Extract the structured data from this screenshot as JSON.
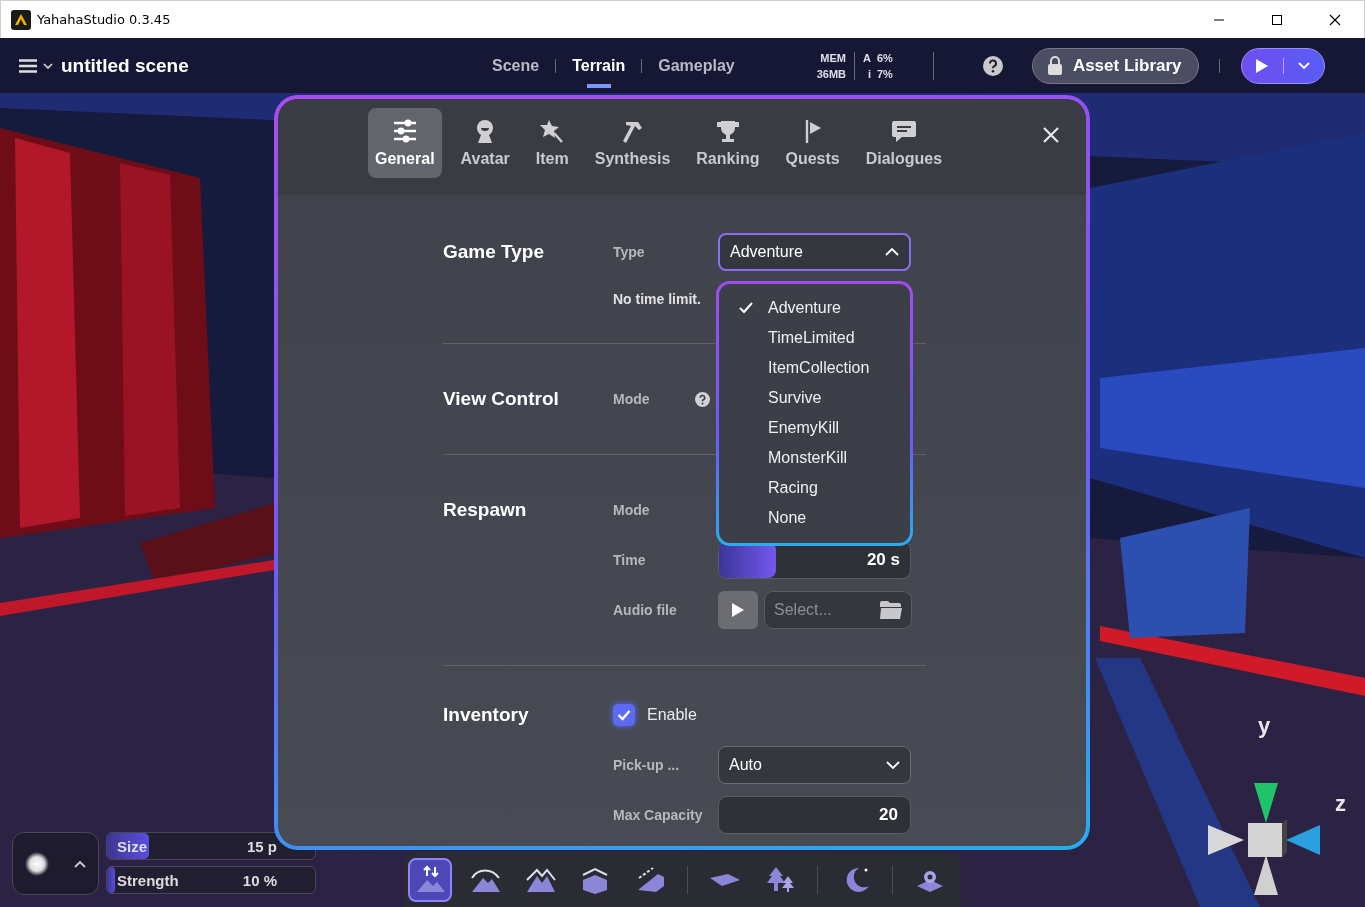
{
  "window": {
    "title": "YahahaStudio 0.3.45"
  },
  "toolbar": {
    "scene_name": "untitled scene",
    "modes": [
      {
        "label": "Scene",
        "selected": false
      },
      {
        "label": "Terrain",
        "selected": true
      },
      {
        "label": "Gameplay",
        "selected": false
      }
    ],
    "stats": {
      "memory": {
        "label": "MEM",
        "value": "36MB"
      },
      "usage": [
        {
          "label": "A",
          "value": "6%"
        },
        {
          "label": "i",
          "value": "7%"
        }
      ]
    },
    "asset_library_button": "Asset Library"
  },
  "dialog": {
    "tabs": [
      {
        "label": "General",
        "selected": true
      },
      {
        "label": "Avatar",
        "selected": false
      },
      {
        "label": "Item",
        "selected": false
      },
      {
        "label": "Synthesis",
        "selected": false
      },
      {
        "label": "Ranking",
        "selected": false
      },
      {
        "label": "Quests",
        "selected": false
      },
      {
        "label": "Dialogues",
        "selected": false
      }
    ],
    "sections": [
      {
        "title": "Game Type",
        "rows": [
          {
            "kind": "select",
            "label": "Type",
            "value": "Adventure",
            "expanded": true
          },
          {
            "kind": "note",
            "text": "No time limit."
          }
        ]
      },
      {
        "title": "View Control",
        "rows": [
          {
            "kind": "covered",
            "label": "Mode",
            "help": true
          }
        ]
      },
      {
        "title": "Respawn",
        "rows": [
          {
            "kind": "covered",
            "label": "Mode",
            "help": false
          },
          {
            "kind": "slider",
            "label": "Time",
            "level": 0.3,
            "reading": "20 s"
          },
          {
            "kind": "file",
            "label": "Audio file",
            "placeholder": "Select..."
          }
        ]
      },
      {
        "title": "Inventory",
        "rows": [
          {
            "kind": "checkbox",
            "label": "Enable",
            "checked": true
          },
          {
            "kind": "select",
            "label": "Pick-up ...",
            "value": "Auto",
            "expanded": false
          },
          {
            "kind": "number",
            "label": "Max Capacity",
            "value": "20"
          }
        ]
      }
    ],
    "dropdown": {
      "options": [
        {
          "label": "Adventure",
          "selected": true
        },
        {
          "label": "TimeLimited",
          "selected": false
        },
        {
          "label": "ItemCollection",
          "selected": false
        },
        {
          "label": "Survive",
          "selected": false
        },
        {
          "label": "EnemyKill",
          "selected": false
        },
        {
          "label": "MonsterKill",
          "selected": false
        },
        {
          "label": "Racing",
          "selected": false
        },
        {
          "label": "None",
          "selected": false
        }
      ]
    }
  },
  "brush": {
    "sliders": [
      {
        "label": "Size",
        "level": 0.2,
        "reading": "15 p"
      },
      {
        "label": "Strength",
        "level": 0.04,
        "reading": "10 %"
      }
    ]
  },
  "terrain_tools": [
    {
      "selected": true
    },
    {
      "selected": false
    },
    {
      "selected": false
    },
    {
      "selected": false
    },
    {
      "selected": false
    },
    {
      "selected": false
    },
    {
      "selected": false
    },
    {
      "selected": false
    },
    {
      "selected": false
    }
  ],
  "gizmo": {
    "axes": [
      {
        "label": "y"
      },
      {
        "label": "z"
      }
    ]
  }
}
